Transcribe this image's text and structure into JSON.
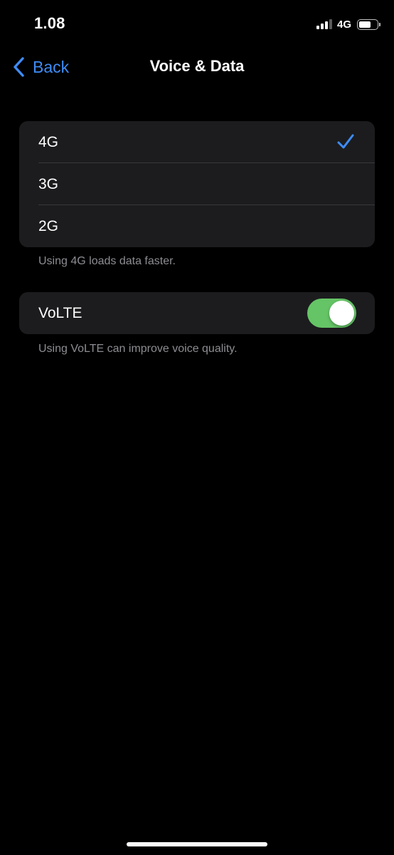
{
  "status_bar": {
    "time": "1.08",
    "network_type": "4G",
    "signal_strength": "3 of 4 bars",
    "battery_level": 0.7,
    "icons": [
      "signal-bars-icon",
      "battery-icon"
    ]
  },
  "nav": {
    "back_label": "Back",
    "title": "Voice & Data",
    "back_icon": "chevron-left-icon"
  },
  "network_options": {
    "items": [
      {
        "label": "4G",
        "selected": true
      },
      {
        "label": "3G",
        "selected": false
      },
      {
        "label": "2G",
        "selected": false
      }
    ],
    "footnote": "Using 4G loads data faster.",
    "check_icon": "checkmark-icon"
  },
  "volte": {
    "label": "VoLTE",
    "enabled": true,
    "footnote": "Using VoLTE can improve voice quality."
  },
  "colors": {
    "background": "#000000",
    "group_background": "#1c1c1e",
    "accent_blue": "#3f8cf6",
    "toggle_on": "#65c466",
    "secondary_text": "#8d8d93"
  }
}
